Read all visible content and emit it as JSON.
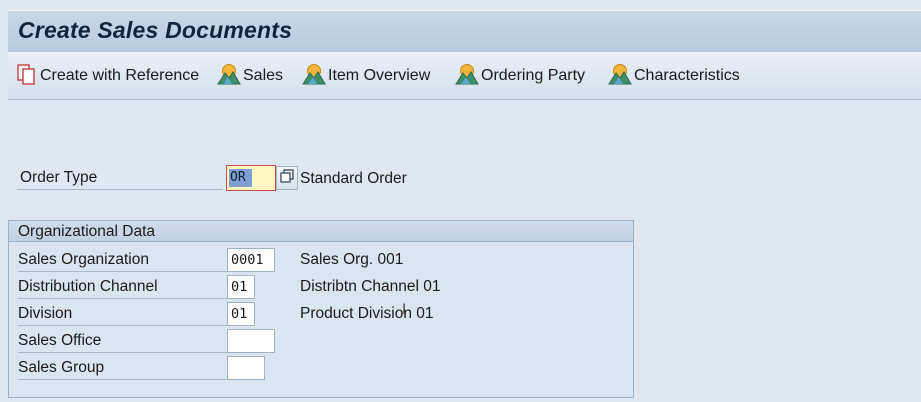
{
  "header": {
    "title": "Create Sales Documents"
  },
  "toolbar": {
    "create_with_reference": "Create with Reference",
    "sales": "Sales",
    "item_overview": "Item Overview",
    "ordering_party": "Ordering Party",
    "characteristics": "Characteristics"
  },
  "order_type": {
    "label": "Order Type",
    "value": "OR",
    "description": "Standard Order"
  },
  "org_data": {
    "title": "Organizational Data",
    "sales_organization": {
      "label": "Sales Organization",
      "value": "0001",
      "description": "Sales Org. 001"
    },
    "distribution_channel": {
      "label": "Distribution Channel",
      "value": "01",
      "description": "Distribtn Channel 01"
    },
    "division": {
      "label": "Division",
      "value": "01",
      "description": "Product Division 01"
    },
    "sales_office": {
      "label": "Sales Office",
      "value": ""
    },
    "sales_group": {
      "label": "Sales Group",
      "value": ""
    }
  },
  "colors": {
    "background": "#dfe8f1",
    "title_bar": "#c2d3e5",
    "required_border": "#d24a4a",
    "selection": "#7f9fd0",
    "active_field": "#fff8c2"
  },
  "icons": {
    "create_with_reference": "document-copy-icon",
    "sales": "mountain-sun-icon",
    "item_overview": "mountain-sun-icon",
    "ordering_party": "mountain-sun-icon",
    "characteristics": "mountain-sun-icon",
    "value_help": "value-help-icon"
  }
}
